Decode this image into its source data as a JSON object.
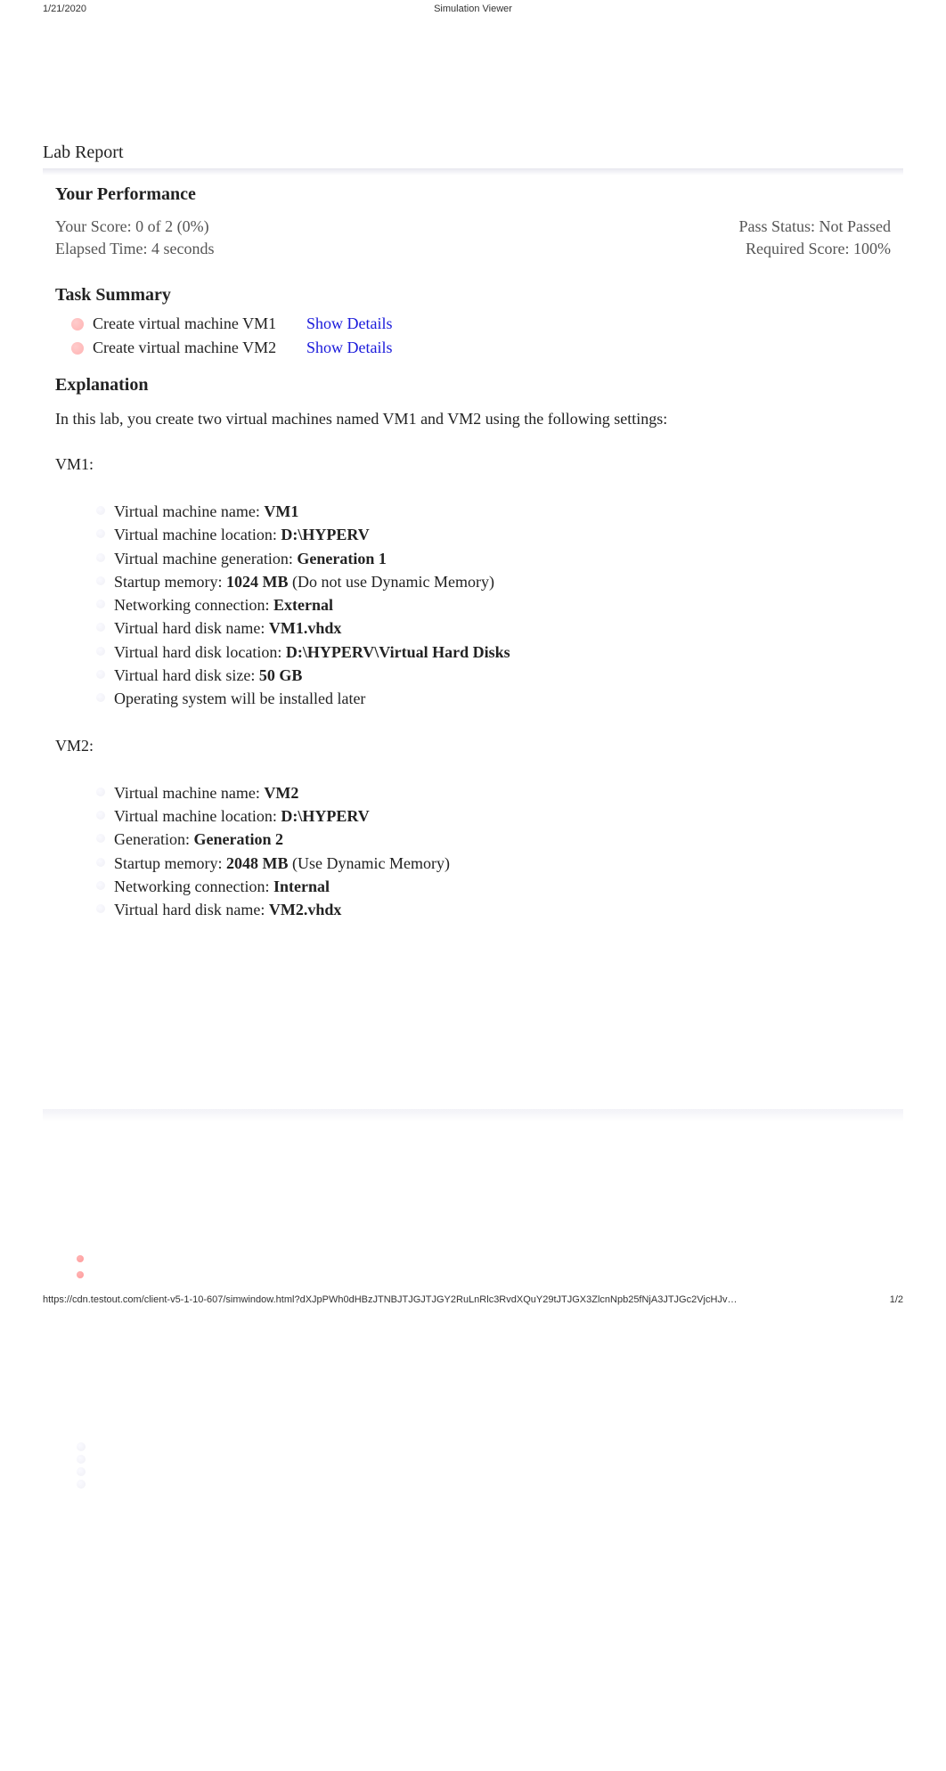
{
  "header": {
    "date": "1/21/2020",
    "title": "Simulation Viewer"
  },
  "lab": {
    "title": "Lab Report"
  },
  "performance": {
    "heading": "Your Performance",
    "score_label": "Your Score: 0 of 2 (0%)",
    "pass_status": "Pass Status: Not Passed",
    "elapsed_time": "Elapsed Time: 4 seconds",
    "required_score": "Required Score: 100%"
  },
  "task_summary": {
    "heading": "Task Summary",
    "items": [
      {
        "label": "Create virtual machine VM1",
        "action": "Show Details"
      },
      {
        "label": "Create virtual machine VM2",
        "action": "Show Details"
      }
    ]
  },
  "explanation": {
    "heading": "Explanation",
    "intro": "In this lab, you create two virtual machines named VM1 and VM2 using the following settings:",
    "vm1_label": "VM1:",
    "vm1": [
      {
        "key": "Virtual machine name: ",
        "val": "VM1",
        "bold": true,
        "note": ""
      },
      {
        "key": "Virtual machine location: ",
        "val": "D:\\HYPERV",
        "bold": true,
        "note": ""
      },
      {
        "key": "Virtual machine generation: ",
        "val": "Generation 1",
        "bold": true,
        "note": ""
      },
      {
        "key": "Startup memory: ",
        "val": "1024 MB",
        "bold": true,
        "note": " (Do not use Dynamic Memory)"
      },
      {
        "key": "Networking connection: ",
        "val": "External",
        "bold": true,
        "note": ""
      },
      {
        "key": "Virtual hard disk name: ",
        "val": "VM1.vhdx",
        "bold": true,
        "note": ""
      },
      {
        "key": "Virtual hard disk location: ",
        "val": "D:\\HYPERV\\Virtual Hard Disks",
        "bold": true,
        "note": ""
      },
      {
        "key": "Virtual hard disk size: ",
        "val": "50 GB",
        "bold": true,
        "note": ""
      },
      {
        "key": "Operating system will be installed later",
        "val": "",
        "bold": false,
        "note": ""
      }
    ],
    "vm2_label": "VM2:",
    "vm2": [
      {
        "key": "Virtual machine name: ",
        "val": "VM2",
        "bold": true,
        "note": ""
      },
      {
        "key": "Virtual machine location: ",
        "val": "D:\\HYPERV",
        "bold": true,
        "note": ""
      },
      {
        "key": "Generation: ",
        "val": "Generation 2",
        "bold": true,
        "note": ""
      },
      {
        "key": "Startup memory: ",
        "val": "2048 MB",
        "bold": true,
        "note": " (Use Dynamic Memory)"
      },
      {
        "key": "Networking connection: ",
        "val": "Internal",
        "bold": true,
        "note": ""
      },
      {
        "key": "Virtual hard disk name: ",
        "val": "VM2.vhdx",
        "bold": true,
        "note": ""
      }
    ]
  },
  "footer": {
    "url": "https://cdn.testout.com/client-v5-1-10-607/simwindow.html?dXJpPWh0dHBzJTNBJTJGJTJGY2RuLnRlc3RvdXQuY29tJTJGX3ZlcnNpb25fNjA3JTJGc2VjcHJv…",
    "page": "1/2"
  }
}
